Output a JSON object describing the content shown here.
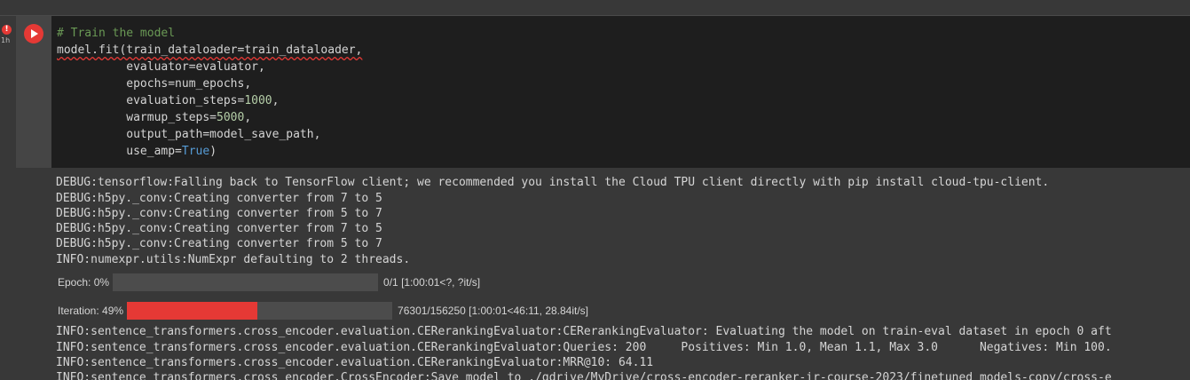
{
  "cell": {
    "error_badge": "!",
    "elapsed": "1h",
    "code": {
      "comment": "# Train the model",
      "line1": "model.fit(train_dataloader=train_dataloader,",
      "line2": "          evaluator=evaluator,",
      "line3": "          epochs=num_epochs,",
      "line4_key": "          evaluation_steps=",
      "line4_val": "1000",
      "line4_end": ",",
      "line5_key": "          warmup_steps=",
      "line5_val": "5000",
      "line5_end": ",",
      "line6": "          output_path=model_save_path,",
      "line7_key": "          use_amp=",
      "line7_val": "True",
      "line7_end": ")"
    }
  },
  "output": {
    "log_lines_top": [
      "DEBUG:tensorflow:Falling back to TensorFlow client; we recommended you install the Cloud TPU client directly with pip install cloud-tpu-client.",
      "DEBUG:h5py._conv:Creating converter from 7 to 5",
      "DEBUG:h5py._conv:Creating converter from 5 to 7",
      "DEBUG:h5py._conv:Creating converter from 7 to 5",
      "DEBUG:h5py._conv:Creating converter from 5 to 7",
      "INFO:numexpr.utils:NumExpr defaulting to 2 threads."
    ],
    "epoch_bar": {
      "label": "Epoch: 0%",
      "progress": 0.0,
      "status": "0/1 [1:00:01<?, ?it/s]"
    },
    "iteration_bar": {
      "label": "Iteration: 49%",
      "progress": 0.49,
      "status": "76301/156250 [1:00:01<46:11, 28.84it/s]"
    },
    "log_lines_bottom": [
      "INFO:sentence_transformers.cross_encoder.evaluation.CERerankingEvaluator:CERerankingEvaluator: Evaluating the model on train-eval dataset in epoch 0 aft",
      "INFO:sentence_transformers.cross_encoder.evaluation.CERerankingEvaluator:Queries: 200     Positives: Min 1.0, Mean 1.1, Max 3.0      Negatives: Min 100.",
      "INFO:sentence_transformers.cross_encoder.evaluation.CERerankingEvaluator:MRR@10: 64.11",
      "INFO:sentence_transformers.cross_encoder.CrossEncoder:Save model to ./gdrive/MyDrive/cross-encoder-reranker-ir-course-2023/finetuned_models-copy/cross-e"
    ]
  },
  "colors": {
    "accent_red": "#e53935",
    "editor_bg": "#1e1e1e",
    "output_bg": "#383838",
    "comment": "#6a9955",
    "number": "#b5cea8",
    "keyword": "#569cd6"
  }
}
